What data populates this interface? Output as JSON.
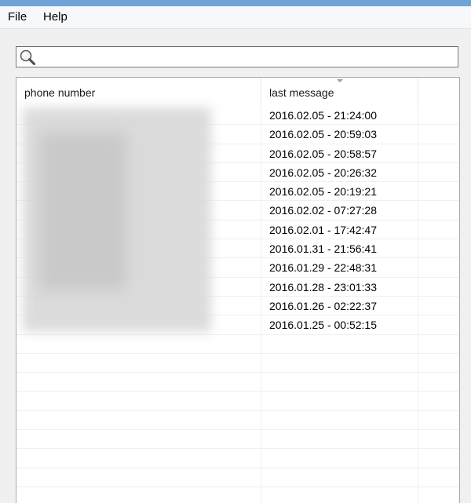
{
  "menu": {
    "file": "File",
    "help": "Help"
  },
  "search": {
    "value": "",
    "icon": "search-icon"
  },
  "columns": {
    "phone": "phone number",
    "last_message": "last message"
  },
  "rows": [
    {
      "last_message": "2016.02.05 - 21:24:00"
    },
    {
      "last_message": "2016.02.05 - 20:59:03"
    },
    {
      "last_message": "2016.02.05 - 20:58:57"
    },
    {
      "last_message": "2016.02.05 - 20:26:32"
    },
    {
      "last_message": "2016.02.05 - 20:19:21"
    },
    {
      "last_message": "2016.02.02 - 07:27:28"
    },
    {
      "last_message": "2016.02.01 - 17:42:47"
    },
    {
      "last_message": "2016.01.31 - 21:56:41"
    },
    {
      "last_message": "2016.01.29 - 22:48:31"
    },
    {
      "last_message": "2016.01.28 - 23:01:33"
    },
    {
      "last_message": "2016.01.26 - 02:22:37"
    },
    {
      "last_message": "2016.01.25 - 00:52:15"
    }
  ],
  "empty_rows": 9,
  "colors": {
    "title_bar": "#6fa3d8",
    "window_bg": "#f0f0f0",
    "list_bg": "#ffffff"
  }
}
